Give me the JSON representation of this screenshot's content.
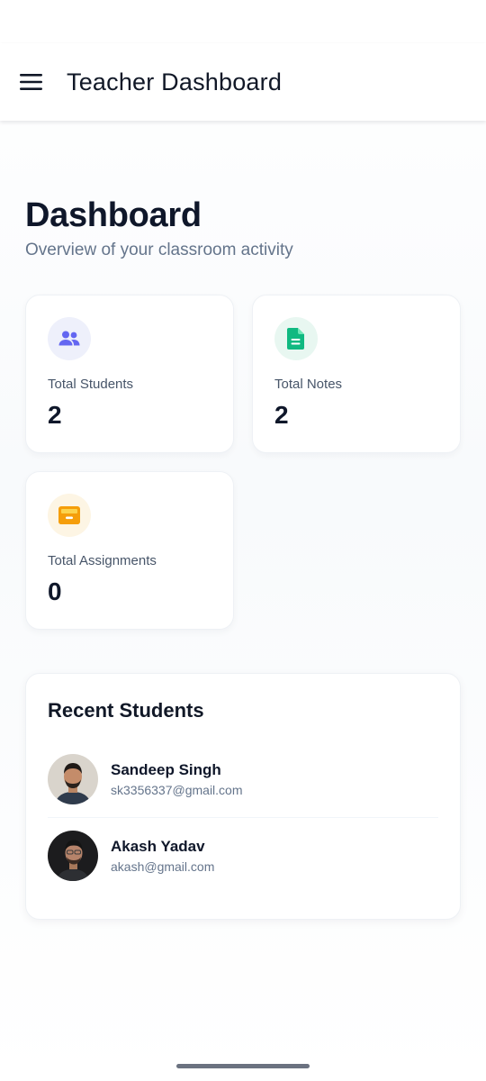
{
  "app_bar": {
    "title": "Teacher Dashboard",
    "menu_icon": "hamburger-menu-icon"
  },
  "header": {
    "title": "Dashboard",
    "subtitle": "Overview of your classroom activity"
  },
  "stats": [
    {
      "label": "Total Students",
      "value": "2",
      "icon": "users-icon",
      "icon_color": "#6366f1",
      "icon_bg": "#eef0fb"
    },
    {
      "label": "Total Notes",
      "value": "2",
      "icon": "document-icon",
      "icon_color": "#10b981",
      "icon_bg": "#e8f7f1"
    },
    {
      "label": "Total Assignments",
      "value": "0",
      "icon": "inbox-icon",
      "icon_color": "#f59e0b",
      "icon_bg": "#fdf5e4"
    }
  ],
  "recent_students": {
    "title": "Recent Students",
    "items": [
      {
        "name": "Sandeep Singh",
        "email": "sk3356337@gmail.com",
        "avatar": "avatar-photo"
      },
      {
        "name": "Akash Yadav",
        "email": "akash@gmail.com",
        "avatar": "avatar-photo"
      }
    ]
  }
}
